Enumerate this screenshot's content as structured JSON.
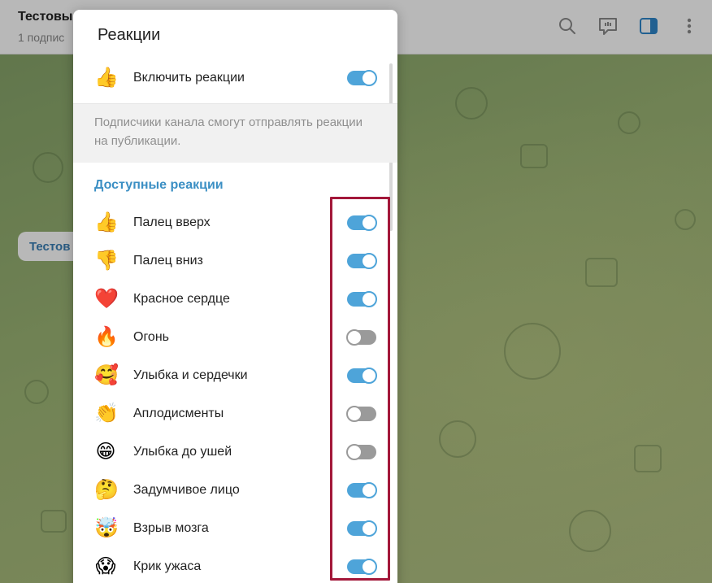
{
  "header": {
    "title": "Тестовы",
    "subtitle": "1 подпис",
    "icons": [
      "search-icon",
      "comments-icon",
      "sidebar-icon",
      "more-icon"
    ]
  },
  "chat": {
    "bubble_text": "Тестов"
  },
  "modal": {
    "title": "Реакции",
    "enable": {
      "emoji": "👍",
      "label": "Включить реакции",
      "on": true
    },
    "info_text": "Подписчики канала смогут отправлять реакции на публикации.",
    "section_title": "Доступные реакции",
    "reactions": [
      {
        "emoji": "👍",
        "label": "Палец вверх",
        "on": true
      },
      {
        "emoji": "👎",
        "label": "Палец вниз",
        "on": true
      },
      {
        "emoji": "❤️",
        "label": "Красное сердце",
        "on": true
      },
      {
        "emoji": "🔥",
        "label": "Огонь",
        "on": false
      },
      {
        "emoji": "🥰",
        "label": "Улыбка и сердечки",
        "on": true
      },
      {
        "emoji": "👏",
        "label": "Аплодисменты",
        "on": false
      },
      {
        "emoji": "😁",
        "label": "Улыбка до ушей",
        "on": false
      },
      {
        "emoji": "🤔",
        "label": "Задумчивое лицо",
        "on": true
      },
      {
        "emoji": "🤯",
        "label": "Взрыв мозга",
        "on": true
      },
      {
        "emoji": "😱",
        "label": "Крик ужаса",
        "on": true
      }
    ]
  },
  "colors": {
    "accent": "#4ea4d9",
    "toggle_off": "#9a9a9a",
    "section": "#3b8fc4",
    "highlight": "#a3183a"
  }
}
